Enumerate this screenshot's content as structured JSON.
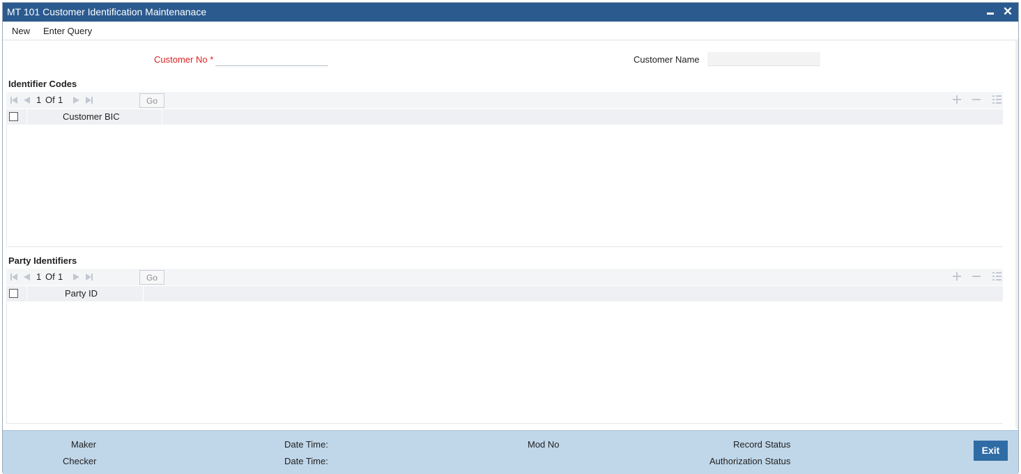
{
  "window": {
    "title": "MT 101 Customer Identification Maintenanace",
    "minimize_icon": "minimize-icon",
    "close_icon": "close-icon",
    "close_glyph": "✕"
  },
  "toolbar": {
    "new_label": "New",
    "enter_query_label": "Enter Query"
  },
  "form": {
    "customer_no_label": "Customer No",
    "required_marker": "*",
    "customer_no_value": "",
    "customer_name_label": "Customer Name",
    "customer_name_value": ""
  },
  "identifier_codes": {
    "title": "Identifier Codes",
    "page_current": "1",
    "page_of": "Of",
    "page_total": "1",
    "go_label": "Go",
    "columns": [
      "Customer BIC"
    ],
    "rows": []
  },
  "party_identifiers": {
    "title": "Party Identifiers",
    "page_current": "1",
    "page_of": "Of",
    "page_total": "1",
    "go_label": "Go",
    "columns": [
      "Party ID"
    ],
    "rows": []
  },
  "footer": {
    "maker_label": "Maker",
    "checker_label": "Checker",
    "date_time_label_1": "Date Time:",
    "date_time_label_2": "Date Time:",
    "mod_no_label": "Mod No",
    "record_status_label": "Record Status",
    "authorization_status_label": "Authorization Status",
    "exit_label": "Exit"
  },
  "colors": {
    "titlebar": "#2b5a8f",
    "required": "#dd2222",
    "footer": "#c0d6e9",
    "exit_button": "#2f6ca5"
  }
}
